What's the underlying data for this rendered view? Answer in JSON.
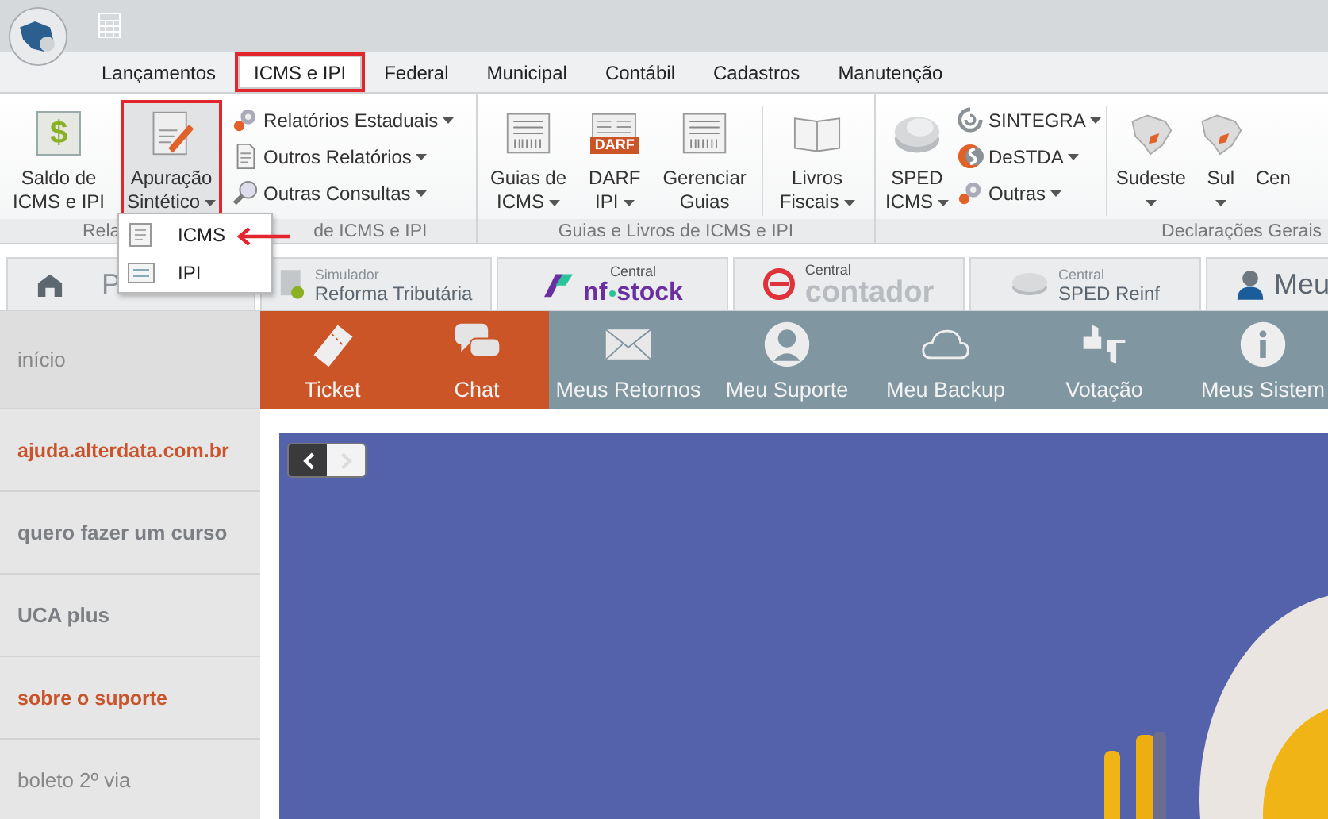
{
  "menu_tabs": [
    {
      "label": "Lançamentos",
      "selected": false,
      "highlighted": false
    },
    {
      "label": "ICMS e IPI",
      "selected": true,
      "highlighted": true
    },
    {
      "label": "Federal",
      "selected": false,
      "highlighted": false
    },
    {
      "label": "Municipal",
      "selected": false,
      "highlighted": false
    },
    {
      "label": "Contábil",
      "selected": false,
      "highlighted": false
    },
    {
      "label": "Cadastros",
      "selected": false,
      "highlighted": false
    },
    {
      "label": "Manutenção",
      "selected": false,
      "highlighted": false
    }
  ],
  "ribbon": {
    "groups": [
      {
        "label_parts": [
          "Rela",
          "de ICMS e IPI"
        ],
        "items": [
          {
            "kind": "big",
            "symbol": "$",
            "lines": [
              "Saldo de",
              "ICMS e IPI"
            ],
            "dropdown": false,
            "highlighted": false
          },
          {
            "kind": "big",
            "lines": [
              "Apuração",
              "Sintético"
            ],
            "dropdown": true,
            "highlighted": true
          },
          {
            "kind": "stack",
            "entries": [
              {
                "label": "Relatórios Estaduais",
                "dropdown": true
              },
              {
                "label": "Outros Relatórios",
                "dropdown": true
              },
              {
                "label": "Outras Consultas",
                "dropdown": true
              }
            ]
          }
        ]
      },
      {
        "label_parts": [
          "Guias e Livros de ICMS e IPI"
        ],
        "items": [
          {
            "kind": "big",
            "lines": [
              "Guias de",
              "ICMS"
            ],
            "dropdown": true,
            "highlighted": false
          },
          {
            "kind": "big",
            "badge": "DARF",
            "lines": [
              "DARF",
              "IPI"
            ],
            "dropdown": true,
            "highlighted": false
          },
          {
            "kind": "big",
            "lines": [
              "Gerenciar",
              "Guias"
            ],
            "dropdown": false,
            "highlighted": false
          },
          {
            "kind": "separator"
          },
          {
            "kind": "big",
            "lines": [
              "Livros",
              "Fiscais"
            ],
            "dropdown": true,
            "highlighted": false
          }
        ]
      },
      {
        "label_parts": [
          "Declarações Gerais"
        ],
        "items": [
          {
            "kind": "big",
            "lines": [
              "SPED",
              "ICMS"
            ],
            "dropdown": true,
            "highlighted": false
          },
          {
            "kind": "stack",
            "entries": [
              {
                "label": "SINTEGRA",
                "dropdown": true
              },
              {
                "label": "DeSTDA",
                "dropdown": true
              },
              {
                "label": "Outras",
                "dropdown": true
              }
            ]
          },
          {
            "kind": "separator"
          },
          {
            "kind": "big",
            "lines": [
              "Sudeste"
            ],
            "dropdown": true,
            "highlighted": false
          },
          {
            "kind": "big",
            "lines": [
              "Sul"
            ],
            "dropdown": true,
            "highlighted": false
          },
          {
            "kind": "big",
            "lines": [
              "Cen"
            ],
            "dropdown": false,
            "highlighted": false
          }
        ]
      }
    ]
  },
  "dropdown_menu": {
    "items": [
      {
        "label": "ICMS"
      },
      {
        "label": "IPI"
      }
    ],
    "pointer_arrow": true
  },
  "tabs": [
    {
      "kind": "home",
      "label": "P"
    },
    {
      "kind": "simulador",
      "small": "Simulador",
      "label": "Reforma Tributária"
    },
    {
      "kind": "nfstock",
      "small": "Central",
      "label_parts": [
        "nf",
        "stock"
      ]
    },
    {
      "kind": "contador",
      "small": "Central",
      "label": "contador"
    },
    {
      "kind": "reinf",
      "small": "Central",
      "label": "SPED Reinf"
    },
    {
      "kind": "person",
      "label": "Meu"
    }
  ],
  "sidebar": {
    "items": [
      {
        "label": "início",
        "kind": "plain",
        "selected": true
      },
      {
        "label": "ajuda.alterdata.com.br",
        "kind": "link",
        "selected": false
      },
      {
        "label": "quero fazer um curso",
        "kind": "bold",
        "selected": false
      },
      {
        "label": "UCA plus",
        "kind": "bold",
        "selected": false
      },
      {
        "label": "sobre o suporte",
        "kind": "link",
        "selected": false
      },
      {
        "label": "boleto 2º via",
        "kind": "plain",
        "selected": false
      }
    ]
  },
  "toolbar": [
    {
      "label": "Ticket",
      "kind": "primary"
    },
    {
      "label": "Chat",
      "kind": "primary"
    },
    {
      "label": "Meus Retornos",
      "kind": "secondary"
    },
    {
      "label": "Meu Suporte",
      "kind": "secondary"
    },
    {
      "label": "Meu Backup",
      "kind": "secondary"
    },
    {
      "label": "Votação",
      "kind": "secondary"
    },
    {
      "label": "Meus Sistem",
      "kind": "secondary"
    }
  ],
  "banner": {
    "kind": "picture",
    "prev_disabled": false,
    "next_disabled": true
  }
}
